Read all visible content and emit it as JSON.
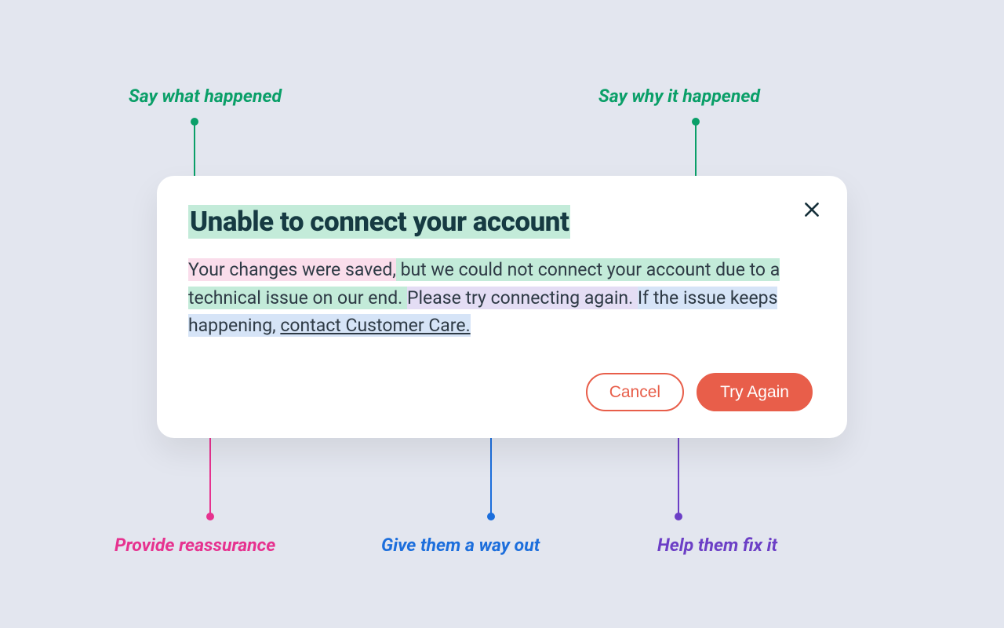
{
  "annotations": {
    "what_happened": "Say what happened",
    "why_happened": "Say why it happened",
    "reassurance": "Provide reassurance",
    "way_out": "Give them a way out",
    "fix_it": "Help them fix it"
  },
  "dialog": {
    "title": "Unable to connect your account",
    "body": {
      "reassurance": "Your changes were saved,",
      "why": " but we could not connect your account due to a technical issue on our end. ",
      "fix": "Please try connecting again. ",
      "way_out_prefix": "If the issue keeps happening, ",
      "way_out_link": "contact Customer Care."
    },
    "buttons": {
      "cancel": "Cancel",
      "try_again": "Try Again"
    }
  },
  "colors": {
    "green": "#0A9F68",
    "pink": "#E6328F",
    "blue": "#1C6EDC",
    "purple": "#6C3FC6",
    "action": "#E85E4A",
    "bg": "#E3E6EF"
  }
}
